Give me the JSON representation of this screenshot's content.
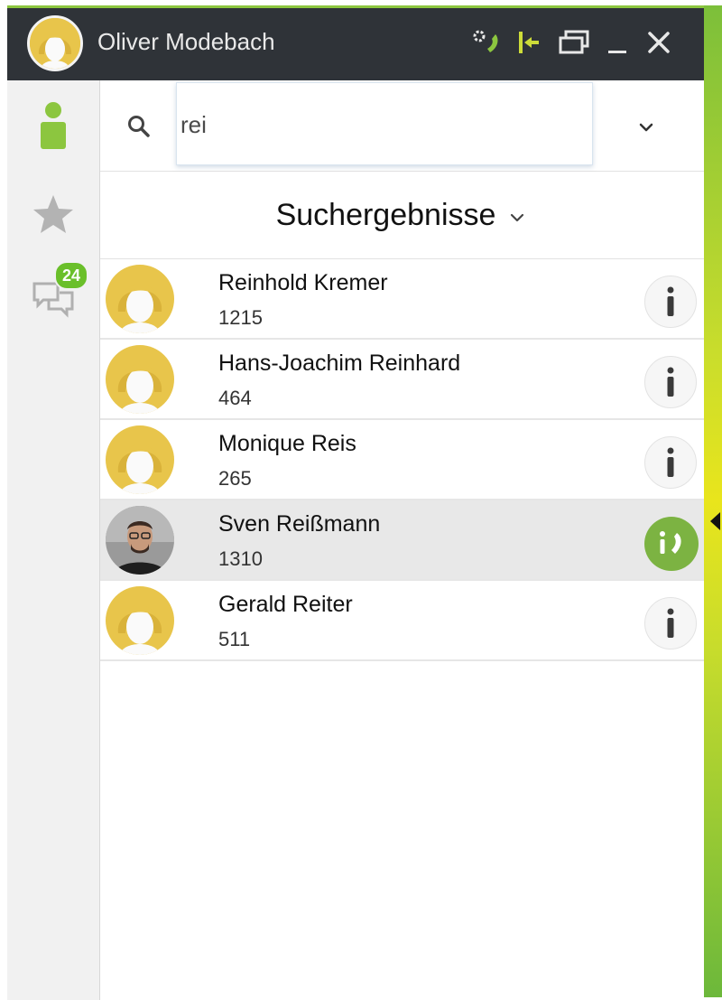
{
  "window": {
    "user_name": "Oliver Modebach",
    "controls": [
      "call-forward-icon",
      "pin-icon",
      "restore-icon",
      "minimize-icon",
      "close-icon"
    ]
  },
  "sidebar": {
    "items": [
      {
        "icon": "contacts-icon"
      },
      {
        "icon": "star-icon"
      },
      {
        "icon": "chat-icon",
        "badge": "24"
      }
    ]
  },
  "search": {
    "value": "rei",
    "placeholder": ""
  },
  "results": {
    "title": "Suchergebnisse",
    "contacts": [
      {
        "name": "Reinhold Kremer",
        "number": "1215",
        "action": "info"
      },
      {
        "name": "Hans-Joachim Reinhard",
        "number": "464",
        "action": "info"
      },
      {
        "name": "Monique Reis",
        "number": "265",
        "action": "info"
      },
      {
        "name": "Sven Reißmann",
        "number": "1310",
        "action": "call"
      },
      {
        "name": "Gerald Reiter",
        "number": "511",
        "action": "info"
      }
    ]
  },
  "colors": {
    "titlebar": "#2f3338",
    "accent_green": "#8cc63f",
    "badge_green": "#6abf2a",
    "avatar_yellow": "#e8c54b",
    "call_green": "#7cb342"
  }
}
